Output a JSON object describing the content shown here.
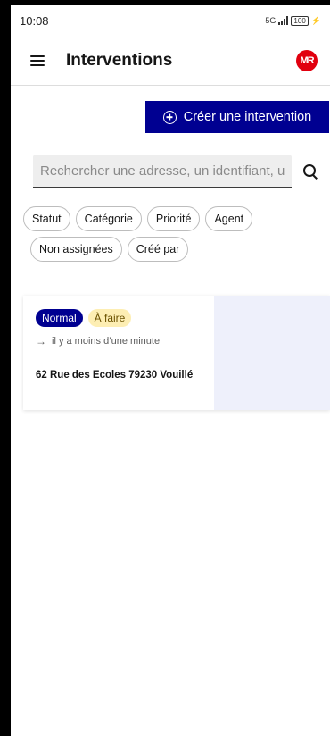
{
  "status_bar": {
    "time": "10:08",
    "network": "5G",
    "battery": "100"
  },
  "header": {
    "title": "Interventions",
    "logo_text": "MR",
    "menu_icon": "hamburger-icon"
  },
  "actions": {
    "create_label": "Créer une intervention",
    "create_icon": "plus-circle-icon"
  },
  "search": {
    "placeholder": "Rechercher une adresse, un identifiant, un"
  },
  "filters": [
    "Statut",
    "Catégorie",
    "Priorité",
    "Agent",
    "Non assignées",
    "Créé par"
  ],
  "interventions": [
    {
      "priority": "Normal",
      "status": "À faire",
      "updated": "il y a moins d’une minute",
      "address": "62 Rue des Ecoles 79230 Vouillé"
    }
  ],
  "colors": {
    "primary": "#000091",
    "status_badge_bg": "#fdeeb3",
    "logo": "#e1000f",
    "card_right_bg": "#eef0fb"
  }
}
